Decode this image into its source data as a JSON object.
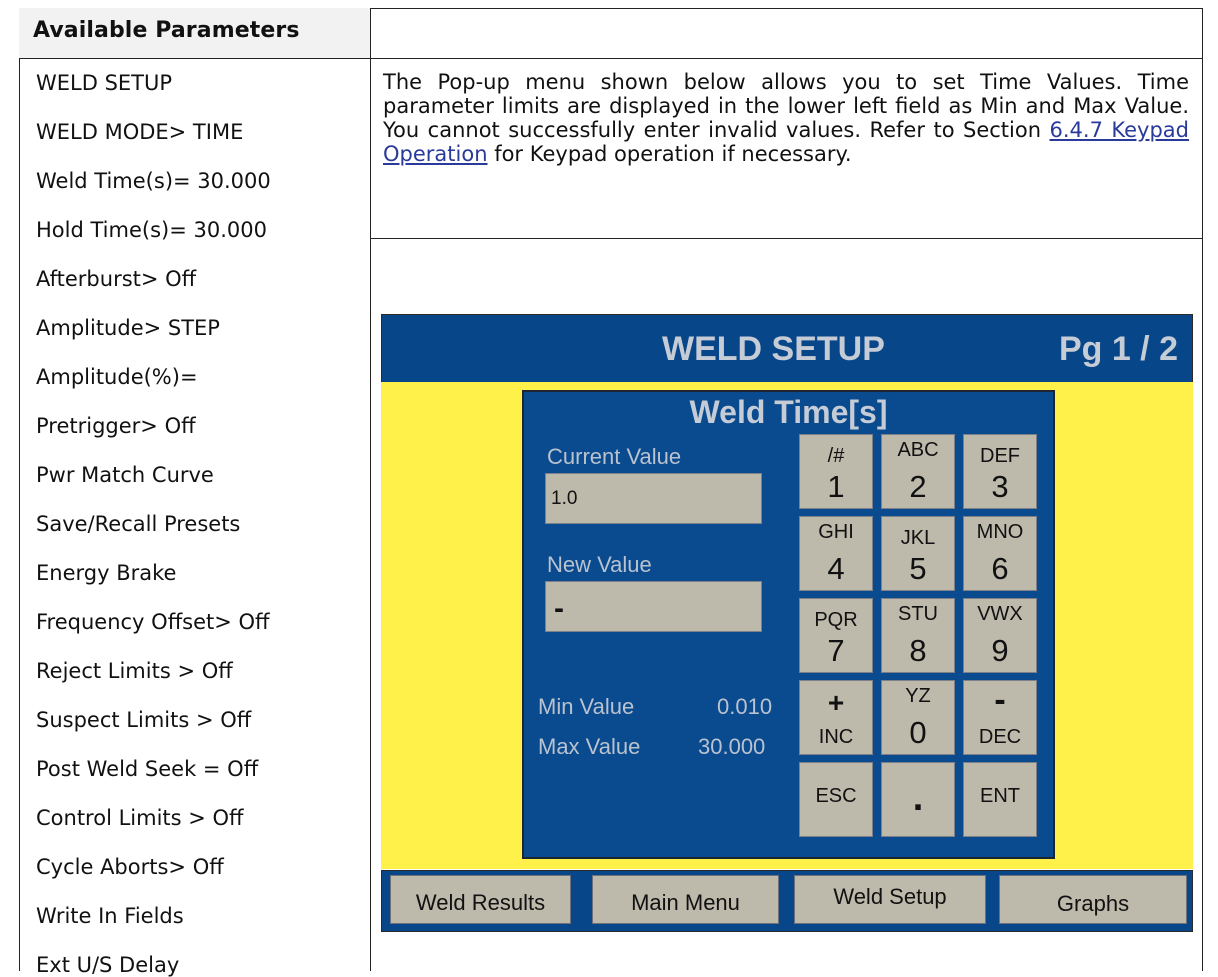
{
  "table": {
    "header": "Available Parameters"
  },
  "parameters": [
    "WELD SETUP",
    "WELD MODE> TIME",
    "Weld Time(s)= 30.000",
    "Hold Time(s)= 30.000",
    "Afterburst> Off",
    "Amplitude> STEP",
    "Amplitude(%)=",
    "Pretrigger> Off",
    "Pwr Match Curve",
    "Save/Recall Presets",
    "Energy Brake",
    "Frequency Offset> Off",
    "Reject Limits > Off",
    "Suspect Limits > Off",
    "Post Weld Seek = Off",
    "Control Limits > Off",
    "Cycle Aborts> Off",
    "Write In Fields",
    "Ext U/S Delay"
  ],
  "description": {
    "before_link": "The Pop-up menu shown below allows you to set Time Values. Time parameter limits are displayed in the lower left field as Min and Max Value. You cannot successfully enter invalid values. Refer to Section ",
    "link": "6.4.7 Keypad Operation",
    "after_link": " for Keypad operation if necessary."
  },
  "screen": {
    "title": "WELD SETUP",
    "page": "Pg 1 / 2",
    "popup": {
      "title": "Weld Time[s]",
      "current_label": "Current Value",
      "current_value": "1.0",
      "new_label": "New Value",
      "new_value": "-",
      "min_label": "Min Value",
      "min_value": "0.010",
      "max_label": "Max Value",
      "max_value": "30.000"
    },
    "keys": {
      "k1": {
        "top": "/#",
        "big": "1"
      },
      "k2": {
        "top": "ABC",
        "big": "2"
      },
      "k3": {
        "top": "DEF",
        "big": "3"
      },
      "k4": {
        "top": "GHI",
        "big": "4"
      },
      "k5": {
        "top": "JKL",
        "big": "5"
      },
      "k6": {
        "top": "MNO",
        "big": "6"
      },
      "k7": {
        "top": "PQR",
        "big": "7"
      },
      "k8": {
        "top": "STU",
        "big": "8"
      },
      "k9": {
        "top": "VWX",
        "big": "9"
      },
      "inc": {
        "top": "+",
        "bottom": "INC"
      },
      "k0": {
        "top": "YZ",
        "big": "0"
      },
      "dec": {
        "top": "-",
        "bottom": "DEC"
      },
      "esc": "ESC",
      "dot": ".",
      "ent": "ENT"
    },
    "nav": [
      "Weld Results",
      "Main Menu",
      "Weld Setup",
      "Graphs"
    ],
    "colors": {
      "title_bar": "#08468a",
      "background": "#fff04a",
      "key": "#bdb9ab",
      "label_text": "#b9c2cf"
    }
  }
}
